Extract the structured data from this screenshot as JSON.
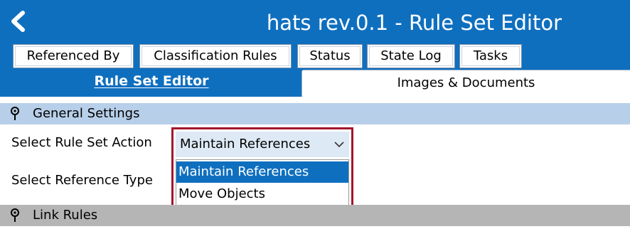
{
  "window": {
    "title": "hats rev.0.1 - Rule Set Editor",
    "accent_color": "#0f6fbf"
  },
  "tabs_top": [
    {
      "label": "Referenced By"
    },
    {
      "label": "Classification Rules"
    },
    {
      "label": "Status"
    },
    {
      "label": "State Log"
    },
    {
      "label": "Tasks"
    }
  ],
  "tabs_second": [
    {
      "label": "Rule Set Editor",
      "active": true
    },
    {
      "label": "Images & Documents",
      "active": false
    }
  ],
  "sections": {
    "general": {
      "label": "General Settings",
      "icon": "pin-icon"
    },
    "link_rules": {
      "label": "Link Rules",
      "icon": "pin-icon"
    }
  },
  "fields": {
    "rule_set_action": {
      "label": "Select Rule Set Action",
      "value": "Maintain References",
      "options": [
        "Maintain References",
        "Move Objects"
      ],
      "highlight_color": "#a3162b"
    },
    "reference_type": {
      "label": "Select Reference Type"
    }
  }
}
